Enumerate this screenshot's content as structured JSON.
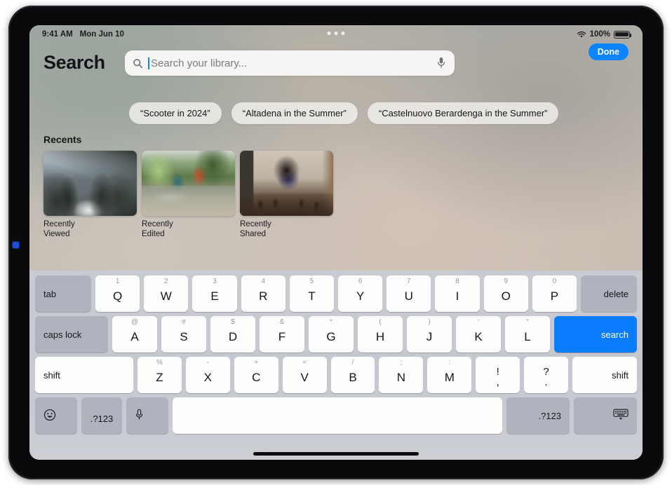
{
  "status_bar": {
    "time": "9:41 AM",
    "date": "Mon Jun 10",
    "battery_percent": "100%",
    "wifi_icon": "wifi-icon",
    "battery_icon": "battery-icon"
  },
  "header": {
    "title": "Search",
    "done_label": "Done",
    "accent_color": "#0a84ff"
  },
  "search": {
    "placeholder": "Search your library...",
    "value": "",
    "search_icon": "search-icon",
    "mic_icon": "microphone-icon"
  },
  "suggestions": [
    {
      "label": "“Scooter in 2024”"
    },
    {
      "label": "“Altadena in the Summer”"
    },
    {
      "label": "“Castelnuovo Berardenga in the Summer”"
    }
  ],
  "recents": {
    "title": "Recents",
    "items": [
      {
        "label": "Recently Viewed",
        "thumb": "coastal-cliffs-photo"
      },
      {
        "label": "Recently Edited",
        "thumb": "stream-hikers-photo"
      },
      {
        "label": "Recently Shared",
        "thumb": "girl-playing-chess-photo"
      }
    ]
  },
  "keyboard": {
    "return_key_label": "search",
    "return_key_color": "#0a7cff",
    "rows": [
      {
        "name": "row-numbers",
        "keys": [
          {
            "name": "tab",
            "main": "tab",
            "alt": ""
          },
          {
            "name": "q",
            "main": "Q",
            "alt": "1"
          },
          {
            "name": "w",
            "main": "W",
            "alt": "2"
          },
          {
            "name": "e",
            "main": "E",
            "alt": "3"
          },
          {
            "name": "r",
            "main": "R",
            "alt": "4"
          },
          {
            "name": "t",
            "main": "T",
            "alt": "5"
          },
          {
            "name": "y",
            "main": "Y",
            "alt": "6"
          },
          {
            "name": "u",
            "main": "U",
            "alt": "7"
          },
          {
            "name": "i",
            "main": "I",
            "alt": "8"
          },
          {
            "name": "o",
            "main": "O",
            "alt": "9"
          },
          {
            "name": "p",
            "main": "P",
            "alt": "0"
          },
          {
            "name": "delete",
            "main": "delete",
            "alt": ""
          }
        ]
      },
      {
        "name": "row-home",
        "keys": [
          {
            "name": "caps-lock",
            "main": "caps lock",
            "alt": ""
          },
          {
            "name": "a",
            "main": "A",
            "alt": "@"
          },
          {
            "name": "s",
            "main": "S",
            "alt": "#"
          },
          {
            "name": "d",
            "main": "D",
            "alt": "$"
          },
          {
            "name": "f",
            "main": "F",
            "alt": "&"
          },
          {
            "name": "g",
            "main": "G",
            "alt": "*"
          },
          {
            "name": "h",
            "main": "H",
            "alt": "("
          },
          {
            "name": "j",
            "main": "J",
            "alt": ")"
          },
          {
            "name": "k",
            "main": "K",
            "alt": "‘"
          },
          {
            "name": "l",
            "main": "L",
            "alt": "“"
          },
          {
            "name": "search-return",
            "main": "search",
            "alt": ""
          }
        ]
      },
      {
        "name": "row-bottom-letters",
        "keys": [
          {
            "name": "shift-left",
            "main": "shift",
            "alt": ""
          },
          {
            "name": "z",
            "main": "Z",
            "alt": "%"
          },
          {
            "name": "x",
            "main": "X",
            "alt": "-"
          },
          {
            "name": "c",
            "main": "C",
            "alt": "+"
          },
          {
            "name": "v",
            "main": "V",
            "alt": "="
          },
          {
            "name": "b",
            "main": "B",
            "alt": "/"
          },
          {
            "name": "n",
            "main": "N",
            "alt": ";"
          },
          {
            "name": "m",
            "main": "M",
            "alt": ":"
          },
          {
            "name": "exclamation-comma",
            "top": "!",
            "bot": ","
          },
          {
            "name": "question-period",
            "top": "?",
            "bot": "."
          },
          {
            "name": "shift-right",
            "main": "shift",
            "alt": ""
          }
        ]
      },
      {
        "name": "row-space",
        "keys": [
          {
            "name": "emoji",
            "main": "☺",
            "alt": ""
          },
          {
            "name": "numbers-left",
            "main": ".?123",
            "alt": ""
          },
          {
            "name": "dictation",
            "main": "",
            "alt": ""
          },
          {
            "name": "space",
            "main": "",
            "alt": ""
          },
          {
            "name": "numbers-right",
            "main": ".?123",
            "alt": ""
          },
          {
            "name": "dismiss-keyboard",
            "main": "",
            "alt": ""
          }
        ]
      }
    ]
  }
}
